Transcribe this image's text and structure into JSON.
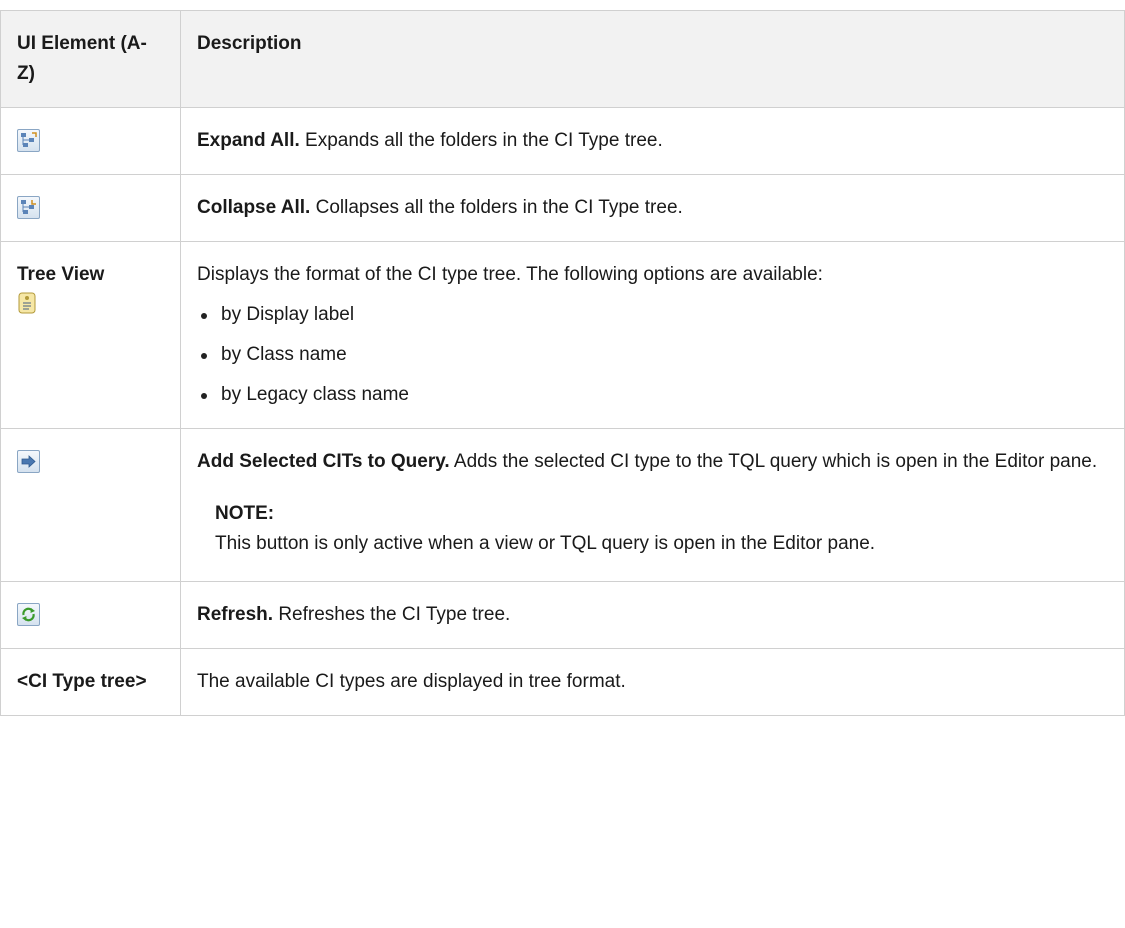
{
  "table": {
    "header": {
      "col1": "UI Element (A-Z)",
      "col2": "Description"
    },
    "rows": [
      {
        "icon": "expand-all-icon",
        "term": "Expand All.",
        "text": "Expands all the folders in the CI Type tree."
      },
      {
        "icon": "collapse-all-icon",
        "term": "Collapse All.",
        "text": "Collapses all the folders in the CI Type tree."
      },
      {
        "element": "Tree View",
        "icon": "tree-view-icon",
        "text": "Displays the format of the CI type tree. The following options are available:",
        "options": [
          "by Display label",
          "by Class name",
          "by Legacy class name"
        ]
      },
      {
        "icon": "add-to-query-arrow-icon",
        "term": "Add Selected CITs to Query.",
        "text": "Adds the selected CI type to the TQL query which is open in the Editor pane.",
        "note_title": "NOTE:",
        "note_text": "This button is only active when a view or TQL query is open in the Editor pane."
      },
      {
        "icon": "refresh-icon",
        "term": "Refresh.",
        "text": "Refreshes the CI Type tree."
      },
      {
        "element": "<CI Type tree>",
        "text": "The available CI types are displayed in tree format."
      }
    ]
  },
  "colors": {
    "header_bg": "#f2f2f2",
    "border": "#d0d0d0",
    "refresh_green": "#3a9a2a"
  }
}
